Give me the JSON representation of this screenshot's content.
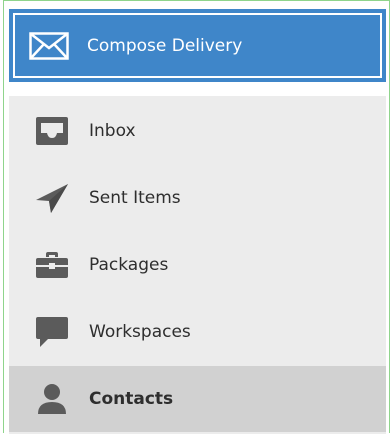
{
  "compose": {
    "label": "Compose Delivery",
    "icon": "envelope-icon"
  },
  "nav": {
    "items": [
      {
        "label": "Inbox",
        "icon": "inbox-tray-icon"
      },
      {
        "label": "Sent Items",
        "icon": "paper-plane-icon"
      },
      {
        "label": "Packages",
        "icon": "briefcase-icon"
      },
      {
        "label": "Workspaces",
        "icon": "chat-bubble-icon"
      },
      {
        "label": "Contacts",
        "icon": "person-icon",
        "active": true
      }
    ]
  },
  "colors": {
    "compose_bg": "#3f86c9",
    "nav_bg": "#ececec",
    "active_bg": "#d1d1d1",
    "icon": "#5b5b5b",
    "frame": "#8fd48c"
  }
}
